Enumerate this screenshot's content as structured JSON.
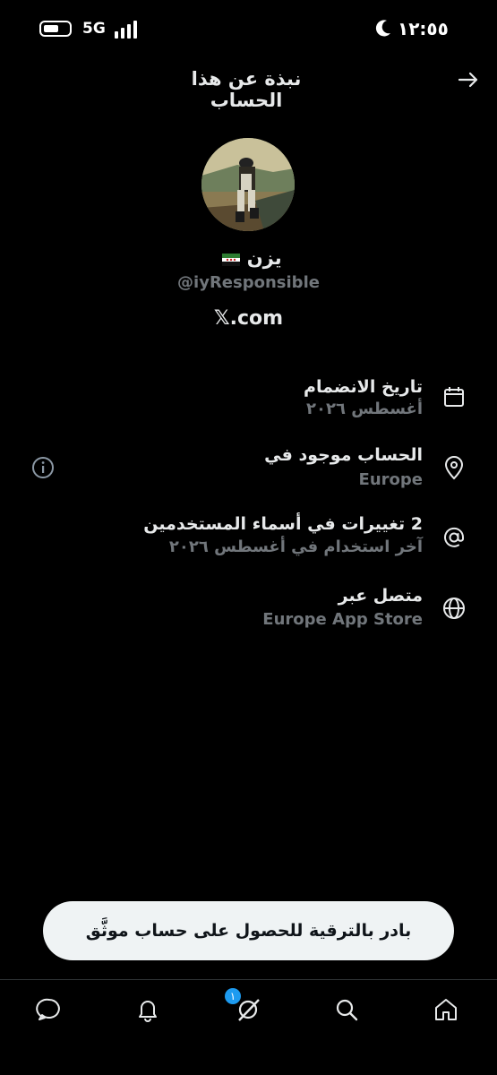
{
  "status_bar": {
    "network": "5G",
    "time": "١٢:٥٥"
  },
  "header": {
    "title": "نبذة عن هذا الحساب"
  },
  "profile": {
    "name": "يزن",
    "handle": "@iyResponsible",
    "site": "𝕏.com"
  },
  "info": {
    "joined": {
      "title": "تاريخ الانضمام",
      "value": "أغسطس ٢٠٢٦",
      "icon": "calendar-icon"
    },
    "location": {
      "title": "الحساب موجود في",
      "value": "Europe",
      "icon": "location-pin-icon"
    },
    "username_changes": {
      "title": "2 تغييرات في أسماء المستخدمين",
      "value": "آخر استخدام في أغسطس ٢٠٢٦",
      "icon": "at-sign-icon"
    },
    "connected_via": {
      "title": "متصل عبر",
      "value": "Europe App Store",
      "icon": "globe-icon"
    }
  },
  "upgrade_button": {
    "label": "بادر بالترقية للحصول على حساب موثَّق"
  },
  "bottom_nav": {
    "badge_count": "١"
  },
  "colors": {
    "background": "#000000",
    "primary_text": "#e7e9ea",
    "secondary_text": "#71767b",
    "accent": "#1d9bf0",
    "pill": "#eff3f4"
  }
}
